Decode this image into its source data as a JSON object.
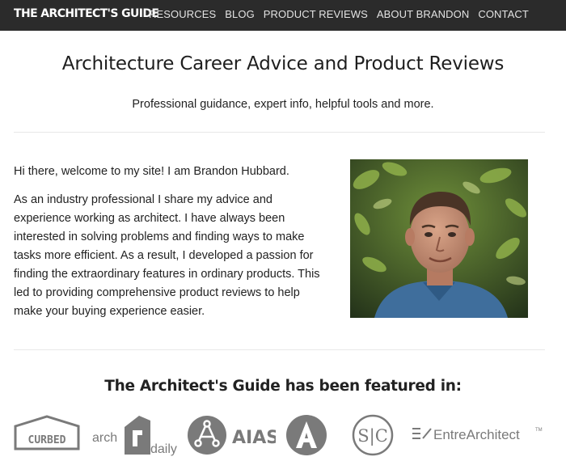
{
  "header": {
    "brand": "THE ARCHITECT'S GUIDE",
    "nav": [
      "RESOURCES",
      "BLOG",
      "PRODUCT REVIEWS",
      "ABOUT BRANDON",
      "CONTACT"
    ]
  },
  "hero": {
    "title": "Architecture Career Advice and Product Reviews",
    "subtitle": "Professional guidance, expert info, helpful tools and more."
  },
  "intro": {
    "greeting": "Hi there, welcome to my site! I am Brandon Hubbard.",
    "body": "As an industry professional I share my advice and experience working as architect. I have always been interested in solving problems and finding ways to make tasks more efficient. As a result, I developed a passion for finding the extraordinary features in ordinary products. This led to providing comprehensive product reviews to help make your buying experience easier."
  },
  "featured": {
    "heading": "The Architect's Guide has been featured in:",
    "logos": {
      "curbed": "CURBED",
      "archdaily_left": "arch",
      "archdaily_right": "daily",
      "aias": "AIAS",
      "sc": "S|C",
      "entre": "EntreArchitect",
      "entre_mark": "TM"
    }
  },
  "colors": {
    "topbar": "#2b2b2b",
    "logo_gray": "#7a7a7a"
  }
}
